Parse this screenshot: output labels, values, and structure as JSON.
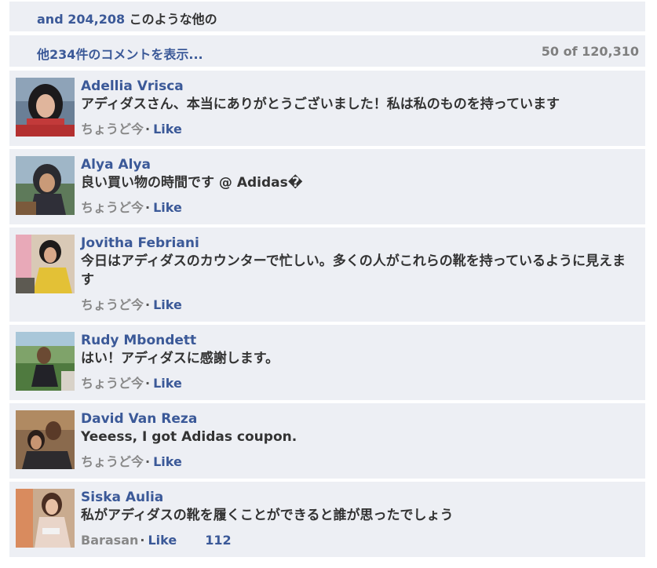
{
  "likes_bar": {
    "text_prefix": "and 204,208",
    "text_suffix": " このような他の"
  },
  "more_bar": {
    "link": "他234件のコメントを表示...",
    "count": "50 of 120,310"
  },
  "comments": [
    {
      "name": "Adellia Vrisca",
      "text": "アディダスさん、本当にありがとうございました！私は私のものを持っています",
      "time": "ちょうど今",
      "like": "Like"
    },
    {
      "name": "Alya Alya",
      "text": "良い買い物の時間です @ Adidas�",
      "time": "ちょうど今",
      "like": "Like"
    },
    {
      "name": "Jovitha Febriani",
      "text": "今日はアディダスのカウンターで忙しい。多くの人がこれらの靴を持っているように見えます",
      "time": "ちょうど今",
      "like": "Like"
    },
    {
      "name": "Rudy Mbondett",
      "text": "はい！アディダスに感謝します。",
      "time": "ちょうど今",
      "like": "Like"
    },
    {
      "name": "David Van Reza",
      "text": "Yeeess, I got Adidas coupon.",
      "time": "ちょうど今",
      "like": "Like"
    },
    {
      "name": "Siska Aulia",
      "text": "私がアディダスの靴を履くことができると誰が思ったでしょう",
      "time": "Barasan",
      "like": "Like",
      "likes_count": "112"
    }
  ],
  "colors": {
    "link": "#3b5998",
    "panel": "#edeff4",
    "text": "#333333",
    "muted": "#888888"
  },
  "icons": {
    "separator": "middle-dot"
  }
}
